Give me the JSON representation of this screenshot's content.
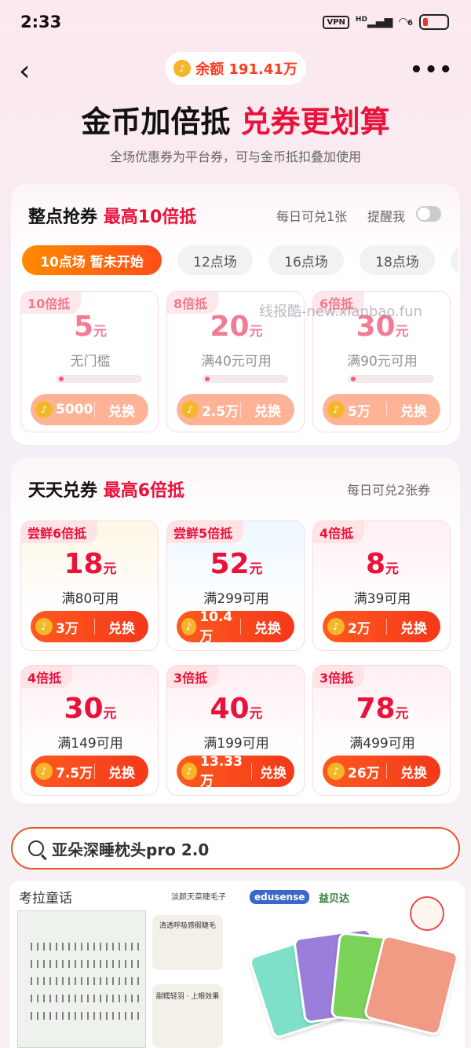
{
  "status_bar": {
    "time": "2:33",
    "vpn": "VPN",
    "signal": "HD",
    "wifi": "6"
  },
  "header": {
    "balance_label": "余额 191.41万",
    "more": "•••",
    "back": "‹"
  },
  "headline": {
    "part1": "金币加倍抵",
    "part2": "兑券更划算",
    "subtitle": "全场优惠券为平台券，可与金币抵扣叠加使用"
  },
  "flash_sale": {
    "title": "整点抢券",
    "title_hl": "最高10倍抵",
    "daily_limit": "每日可兑1张",
    "remind_label": "提醒我",
    "tabs": [
      {
        "label": "10点场  暂未开始",
        "active": true
      },
      {
        "label": "12点场",
        "active": false
      },
      {
        "label": "16点场",
        "active": false
      },
      {
        "label": "18点场",
        "active": false
      }
    ],
    "coupons": [
      {
        "badge": "10倍抵",
        "amount": "5",
        "unit": "元",
        "condition": "无门槛",
        "coins": "5000",
        "action": "兑换",
        "progress": 0.05
      },
      {
        "badge": "8倍抵",
        "amount": "20",
        "unit": "元",
        "condition": "满40元可用",
        "coins": "2.5万",
        "action": "兑换",
        "progress": 0.05
      },
      {
        "badge": "6倍抵",
        "amount": "30",
        "unit": "元",
        "condition": "满90元可用",
        "coins": "5万",
        "action": "兑换",
        "progress": 0.05
      }
    ]
  },
  "daily": {
    "title": "天天兑券",
    "title_hl": "最高6倍抵",
    "daily_limit": "每日可兑2张券",
    "coupons": [
      {
        "badge": "尝鲜6倍抵",
        "amount": "18",
        "unit": "元",
        "condition": "满80可用",
        "coins": "3万",
        "action": "兑换"
      },
      {
        "badge": "尝鲜5倍抵",
        "amount": "52",
        "unit": "元",
        "condition": "满299可用",
        "coins": "10.4万",
        "action": "兑换"
      },
      {
        "badge": "4倍抵",
        "amount": "8",
        "unit": "元",
        "condition": "满39可用",
        "coins": "2万",
        "action": "兑换"
      },
      {
        "badge": "4倍抵",
        "amount": "30",
        "unit": "元",
        "condition": "满149可用",
        "coins": "7.5万",
        "action": "兑换"
      },
      {
        "badge": "3倍抵",
        "amount": "40",
        "unit": "元",
        "condition": "满199可用",
        "coins": "13.33万",
        "action": "兑换"
      },
      {
        "badge": "3倍抵",
        "amount": "78",
        "unit": "元",
        "condition": "满499可用",
        "coins": "26万",
        "action": "兑换"
      }
    ]
  },
  "watermark": "线报酷-new.xianbao.fun",
  "search": {
    "query": "亚朵深睡枕头pro 2.0"
  },
  "products": [
    {
      "brand": "考拉童话",
      "subtitle": "淡颜天菜睫毛子",
      "tag1": "清透呼吸感假睫毛",
      "tag2": "甜糯轻羽 · 上眼效果"
    },
    {
      "brand": "edusense",
      "brand_cn": "益贝达"
    }
  ],
  "colors": {
    "accent": "#e8123b",
    "button": "#f4381a",
    "coin": "#f5b729",
    "tab_active": "#ff6a00"
  }
}
